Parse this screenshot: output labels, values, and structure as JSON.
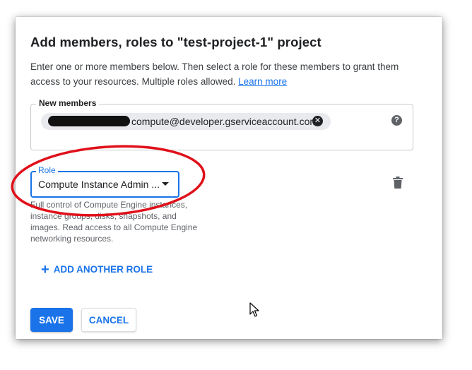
{
  "dialog": {
    "title": "Add members, roles to \"test-project-1\" project",
    "description": "Enter one or more members below. Then select a role for these members to grant them access to your resources. Multiple roles allowed.",
    "learn_more": "Learn more"
  },
  "members": {
    "label": "New members",
    "chip_text": "compute@developer.gserviceaccount.com",
    "chip_remove_icon": "close-circle-icon",
    "help_icon": "help-circle-icon"
  },
  "role": {
    "label": "Role",
    "selected": "Compute Instance Admin ...",
    "description": "Full control of Compute Engine instances, instance groups, disks, snapshots, and images. Read access to all Compute Engine networking resources.",
    "delete_icon": "trash-icon"
  },
  "add_role": {
    "icon": "+",
    "label": "ADD ANOTHER ROLE"
  },
  "footer": {
    "save_label": "SAVE",
    "cancel_label": "CANCEL"
  },
  "colors": {
    "accent": "#1a73e8",
    "annotation": "#e0101a",
    "text": "#202124"
  }
}
